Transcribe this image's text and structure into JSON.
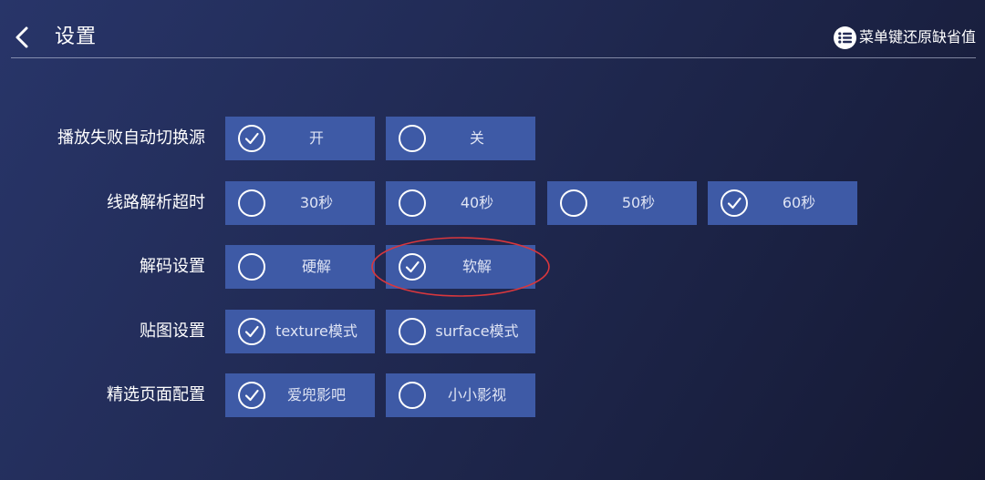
{
  "header": {
    "back_icon": "chevron-left-icon",
    "title": "设置",
    "reset_icon": "menu-list-icon",
    "reset_text": "菜单键还原缺省值"
  },
  "settings": [
    {
      "label": "播放失败自动切换源",
      "options": [
        {
          "label": "开",
          "checked": true
        },
        {
          "label": "关",
          "checked": false
        }
      ]
    },
    {
      "label": "线路解析超时",
      "options": [
        {
          "label": "30秒",
          "checked": false
        },
        {
          "label": "40秒",
          "checked": false
        },
        {
          "label": "50秒",
          "checked": false
        },
        {
          "label": "60秒",
          "checked": true
        }
      ]
    },
    {
      "label": "解码设置",
      "options": [
        {
          "label": "硬解",
          "checked": false
        },
        {
          "label": "软解",
          "checked": true
        }
      ]
    },
    {
      "label": "贴图设置",
      "options": [
        {
          "label": "texture模式",
          "checked": true
        },
        {
          "label": "surface模式",
          "checked": false
        }
      ]
    },
    {
      "label": "精选页面配置",
      "options": [
        {
          "label": "爱兜影吧",
          "checked": true
        },
        {
          "label": "小小影视",
          "checked": false
        }
      ]
    }
  ],
  "annotation": {
    "shape": "ellipse",
    "color": "#d9373d",
    "target": "软解"
  },
  "colors": {
    "option_bg": "#3e5aa6",
    "background": "#222c57"
  }
}
